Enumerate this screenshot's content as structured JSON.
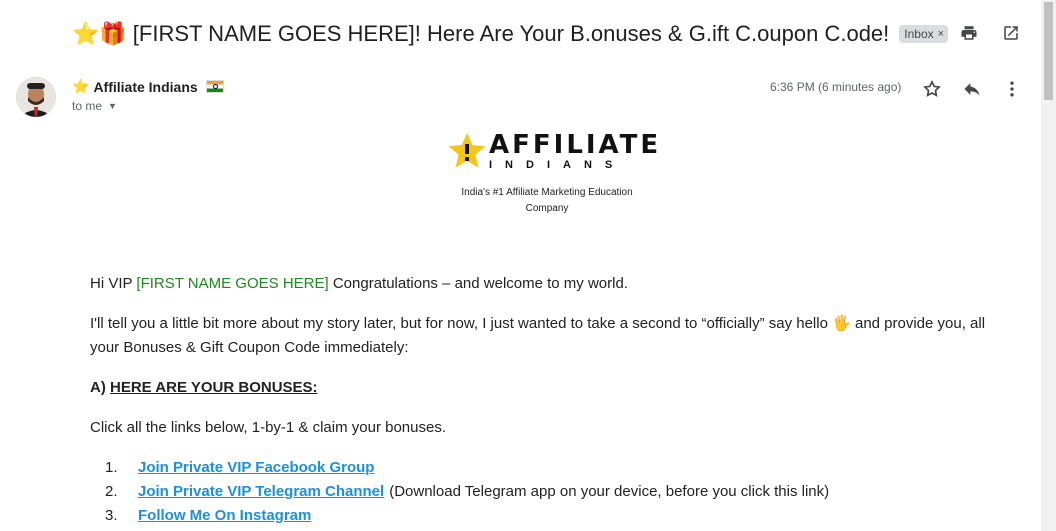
{
  "email": {
    "subject_emojis": "⭐🎁",
    "subject": "[FIRST NAME GOES HERE]! Here Are Your B.onuses & G.ift C.oupon C.ode!",
    "label": "Inbox",
    "label_close": "×"
  },
  "sender": {
    "star": "⭐",
    "name": "Affiliate Indians",
    "to": "to me",
    "timestamp": "6:36 PM (6 minutes ago)"
  },
  "logo": {
    "word": "AFFILIATE",
    "sub": "INDIANS",
    "tagline": "India's #1 Affiliate Marketing Education Company"
  },
  "body": {
    "greeting_prefix": "Hi VIP ",
    "greeting_name": "[FIRST NAME GOES HERE]",
    "greeting_suffix": " Congratulations – and welcome to my world.",
    "intro_a": "I'll tell you a little bit more about my story later, but for now, I just wanted to take a second to “officially” say hello ",
    "intro_wave": "🖐",
    "intro_b": " and provide you, all your Bonuses & Gift Coupon Code immediately:",
    "section_prefix": "A) ",
    "section_title": "HERE ARE YOUR BONUSES:",
    "instructions": "Click all the links below, 1-by-1 & claim your bonuses.",
    "links": [
      {
        "num": "1.",
        "label": "Join Private VIP Facebook Group",
        "note": ""
      },
      {
        "num": "2.",
        "label": "Join Private VIP Telegram Channel",
        "note": "(Download Telegram app on your device, before you click this link)"
      },
      {
        "num": "3.",
        "label": "Follow Me On Instagram",
        "note": ""
      }
    ]
  },
  "icons": {
    "print": "print-icon",
    "open_new": "open-in-new-window-icon",
    "star": "star-icon",
    "reply": "reply-icon",
    "more": "more-vertical-icon"
  },
  "colors": {
    "link": "#1b8fe0",
    "name_highlight": "#1a8a1a",
    "badge_bg": "#dadce0"
  }
}
